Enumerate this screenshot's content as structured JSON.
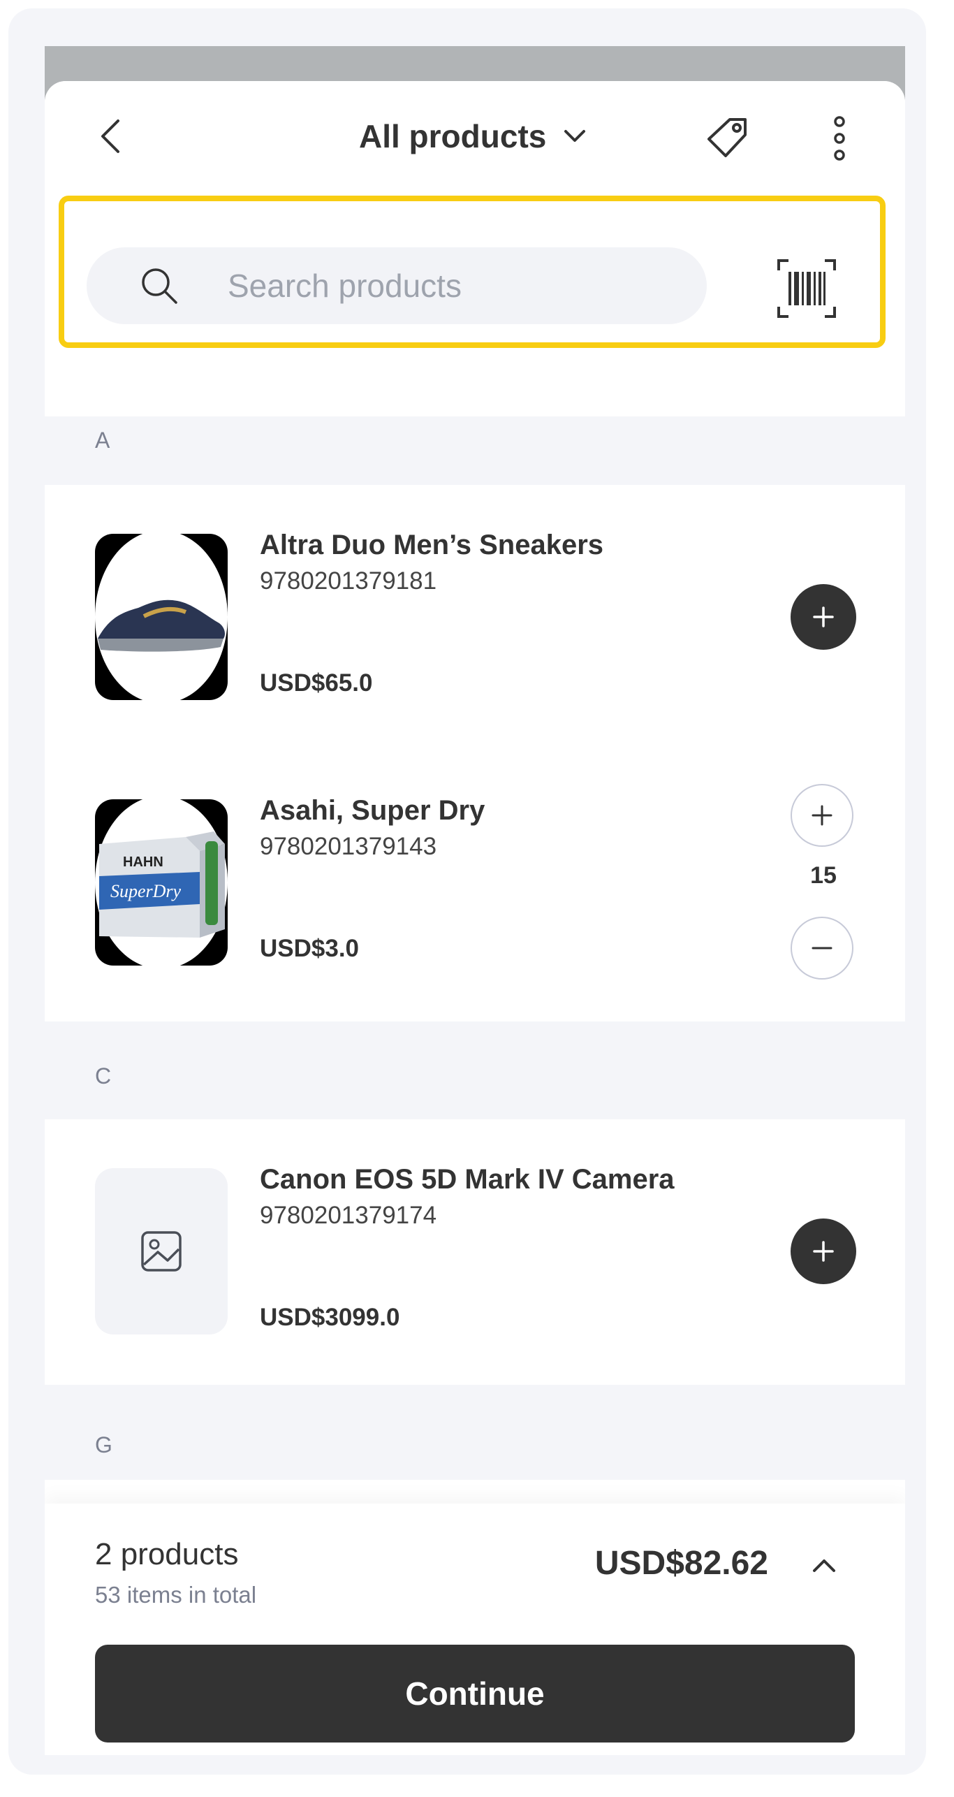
{
  "header": {
    "title": "All products"
  },
  "search": {
    "placeholder": "Search products"
  },
  "sections": [
    {
      "letter": "A",
      "products": [
        {
          "name": "Altra Duo Men’s Sneakers",
          "sku": "9780201379181",
          "price": "USD$65.0"
        },
        {
          "name": "Asahi, Super Dry",
          "sku": "9780201379143",
          "price": "USD$3.0",
          "quantity": "15"
        }
      ]
    },
    {
      "letter": "C",
      "products": [
        {
          "name": "Canon EOS 5D Mark IV Camera",
          "sku": "9780201379174",
          "price": "USD$3099.0"
        }
      ]
    },
    {
      "letter": "G",
      "products": []
    }
  ],
  "footer": {
    "product_count": "2 products",
    "items_total": "53 items in total",
    "total_price": "USD$82.62",
    "continue_label": "Continue"
  },
  "colors": {
    "highlight": "#f8cd12",
    "primary_dark": "#333333",
    "background": "#f4f5f9",
    "muted_text": "#7b8090"
  },
  "icons": [
    "chevron-left-icon",
    "chevron-down-icon",
    "price-tag-icon",
    "more-vertical-icon",
    "search-icon",
    "barcode-scan-icon",
    "plus-icon",
    "minus-icon",
    "image-placeholder-icon",
    "chevron-up-icon"
  ]
}
